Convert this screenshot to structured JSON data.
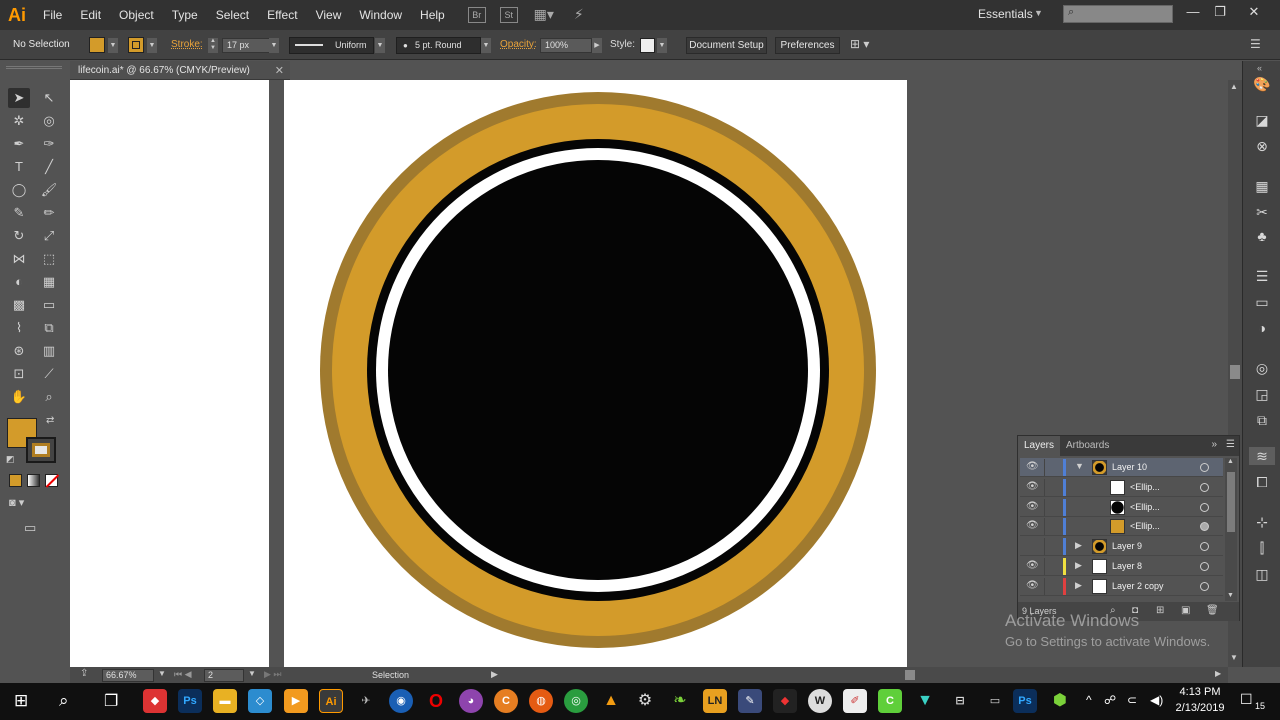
{
  "app": {
    "logo": "Ai",
    "menus": [
      "File",
      "Edit",
      "Object",
      "Type",
      "Select",
      "Effect",
      "View",
      "Window",
      "Help"
    ],
    "menubar_icons": [
      "Br",
      "St"
    ],
    "workspace": "Essentials",
    "search_placeholder": ""
  },
  "control_bar": {
    "selection": "No Selection",
    "fill_color": "#d39b2a",
    "stroke_label": "Stroke:",
    "stroke_weight": "17 px",
    "variable_width": "Uniform",
    "brush": "5 pt. Round",
    "opacity_label": "Opacity:",
    "opacity": "100%",
    "style_label": "Style:",
    "document_setup": "Document Setup",
    "preferences": "Preferences"
  },
  "document": {
    "tab_title": "lifecoin.ai* @ 66.67% (CMYK/Preview)"
  },
  "artwork": {
    "outer_ring_color": "#a07a2e",
    "gold_color": "#d39b2a",
    "black_color": "#050505",
    "white_color": "#ffffff"
  },
  "status_bar": {
    "zoom": "66.67%",
    "artboard": "2",
    "mode": "Selection"
  },
  "layers_panel": {
    "tab_layers": "Layers",
    "tab_artboards": "Artboards",
    "rows": [
      {
        "name": "Layer 10",
        "level": 0,
        "expanded": true,
        "selected": true,
        "visible": true,
        "thumb": "coin",
        "color": "#4f7fd6"
      },
      {
        "name": "<Ellip...",
        "level": 1,
        "visible": true,
        "thumb": "white",
        "color": "#4f7fd6"
      },
      {
        "name": "<Ellip...",
        "level": 1,
        "visible": true,
        "thumb": "black",
        "color": "#4f7fd6"
      },
      {
        "name": "<Ellip...",
        "level": 1,
        "visible": true,
        "thumb": "gold",
        "color": "#4f7fd6"
      },
      {
        "name": "Layer 9",
        "level": 0,
        "expanded": false,
        "visible": false,
        "thumb": "coin",
        "color": "#4f7fd6"
      },
      {
        "name": "Layer 8",
        "level": 0,
        "expanded": false,
        "visible": true,
        "thumb": "wave",
        "color": "#f0e040"
      },
      {
        "name": "Layer 2 copy",
        "level": 0,
        "expanded": false,
        "visible": true,
        "thumb": "figure",
        "color": "#e04040"
      }
    ],
    "count": "9 Layers"
  },
  "watermark": {
    "title": "Activate Windows",
    "subtitle": "Go to Settings to activate Windows."
  },
  "taskbar": {
    "time": "4:13 PM",
    "date": "2/13/2019",
    "notification_count": "15"
  }
}
